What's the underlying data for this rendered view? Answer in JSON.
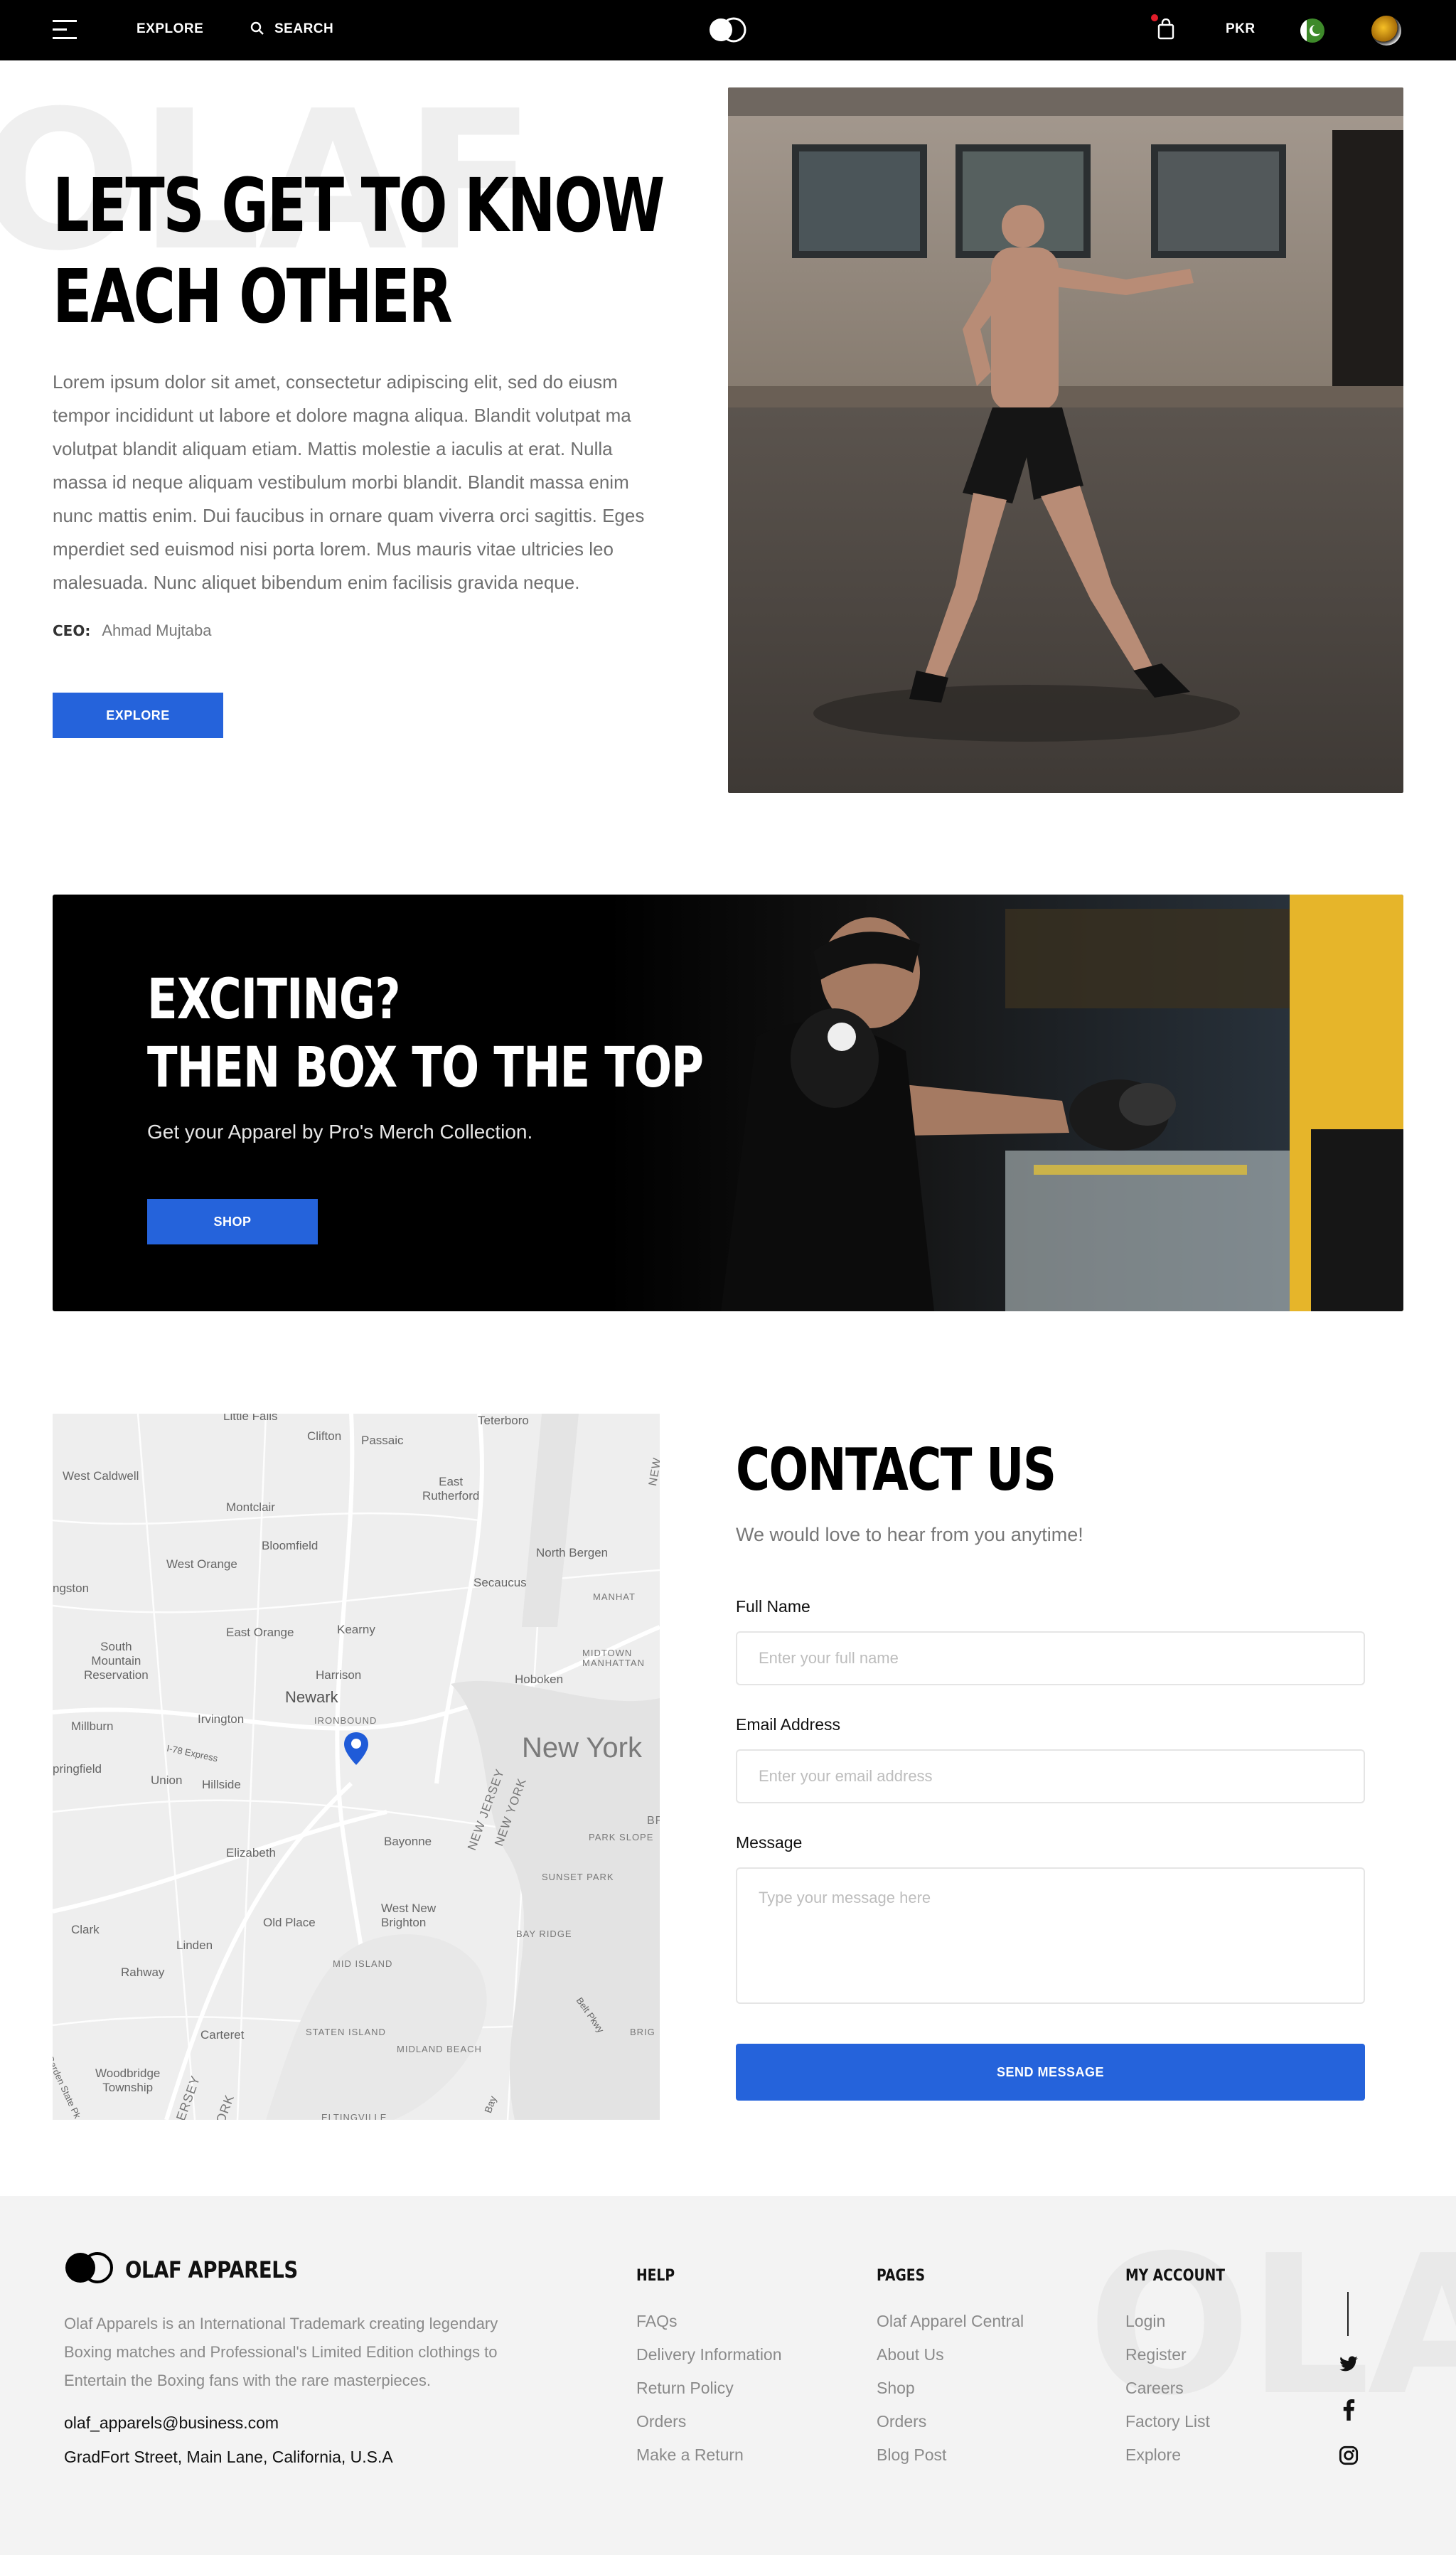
{
  "nav": {
    "explore": "EXPLORE",
    "search": "SEARCH",
    "currency": "PKR",
    "icons": [
      "menu-icon",
      "search-icon",
      "logo-icon",
      "shopping-bag-icon",
      "flag-icon",
      "avatar"
    ]
  },
  "hero": {
    "watermark": "OLAF",
    "title_line1": "LETS GET TO KNOW",
    "title_line2": "EACH OTHER",
    "body": "Lorem ipsum dolor sit amet, consectetur adipiscing elit, sed do eiusm tempor incididunt ut labore et dolore magna aliqua. Blandit volutpat ma volutpat blandit aliquam etiam. Mattis molestie a iaculis at erat. Nulla massa id neque aliquam vestibulum morbi blandit. Blandit massa enim nunc mattis enim. Dui faucibus in ornare quam viverra orci sagittis. Eges mperdiet sed euismod nisi porta lorem. Mus mauris vitae ultricies leo malesuada. Nunc aliquet bibendum enim facilisis gravida neque.",
    "ceo_label": "CEO:",
    "ceo_name": "Ahmad Mujtaba",
    "button": "EXPLORE"
  },
  "banner": {
    "title_line1": "EXCITING?",
    "title_line2": "THEN BOX TO THE TOP",
    "subtitle": "Get your Apparel by Pro's Merch Collection.",
    "button": "SHOP"
  },
  "map": {
    "labels": {
      "little_falls": "Little Falls",
      "clifton": "Clifton",
      "passaic": "Passaic",
      "teterboro": "Teterboro",
      "west_caldwell": "West Caldwell",
      "east_rutherford": "East\nRutherford",
      "montclair": "Montclair",
      "bloomfield": "Bloomfield",
      "north_bergen": "North Bergen",
      "west_orange": "West Orange",
      "secaucus": "Secaucus",
      "manhattan": "MANHAT",
      "livingston": "ngston",
      "east_orange": "East Orange",
      "kearny": "Kearny",
      "south_mountain": "South\nMountain\nReservation",
      "harrison": "Harrison",
      "midtown": "MIDTOWN\nMANHATTAN",
      "hoboken": "Hoboken",
      "newark": "Newark",
      "ironbound": "IRONBOUND",
      "millburn": "Millburn",
      "irvington": "Irvington",
      "new_york": "New York",
      "springfield": "pringfield",
      "union": "Union",
      "hillside": "Hillside",
      "i78": "I-78 Express",
      "new_jersey": "NEW JERSEY",
      "new_york_state": "NEW YORK",
      "park_slope": "PARK SLOPE",
      "bayonne": "Bayonne",
      "elizabeth": "Elizabeth",
      "sunset_park": "SUNSET PARK",
      "west_new_brighton": "West New\nBrighton",
      "clark": "Clark",
      "old_place": "Old Place",
      "bay_ridge": "BAY RIDGE",
      "linden": "Linden",
      "mid_island": "MID ISLAND",
      "rahway": "Rahway",
      "carteret": "Carteret",
      "staten_island": "STATEN ISLAND",
      "midland_beach": "MIDLAND BEACH",
      "woodbridge": "Woodbridge\nTownship",
      "garden_state": "Garden State Pk",
      "new_jersey_2": "ERSEY",
      "york_2": "ORK",
      "eltingville": "ELTINGVILLE",
      "bay": "Bay",
      "belt_pkwy": "Belt Pkwy",
      "brig": "BRIG",
      "new_north": "NEW",
      "br": "BR"
    },
    "pin": "location-pin-icon"
  },
  "contact": {
    "title": "CONTACT US",
    "subtitle": "We would love to hear from you anytime!",
    "full_name_label": "Full Name",
    "full_name_placeholder": "Enter your full name",
    "email_label": "Email Address",
    "email_placeholder": "Enter your email address",
    "message_label": "Message",
    "message_placeholder": "Type your message here",
    "button": "SEND MESSAGE"
  },
  "footer": {
    "brand": "OLAF APPARELS",
    "about": "Olaf Apparels is an International Trademark creating legendary Boxing matches and Professional's Limited Edition clothings to Entertain the Boxing fans with the rare masterpieces.",
    "email": "olaf_apparels@business.com",
    "address": "GradFort Street, Main Lane, California, U.S.A",
    "watermark": "OLAF",
    "help": {
      "title": "HELP",
      "items": [
        "FAQs",
        "Delivery Information",
        "Return Policy",
        "Orders",
        "Make a Return"
      ]
    },
    "pages": {
      "title": "PAGES",
      "items": [
        "Olaf Apparel Central",
        "About Us",
        "Shop",
        "Orders",
        "Blog Post"
      ]
    },
    "account": {
      "title": "MY ACCOUNT",
      "items": [
        "Login",
        "Register",
        "Careers",
        "Factory List",
        "Explore"
      ]
    },
    "social": [
      "twitter-icon",
      "facebook-icon",
      "instagram-icon"
    ]
  },
  "colors": {
    "accent": "#2563db",
    "nav_bg": "#000000",
    "footer_bg": "#f3f3f3",
    "notification": "#e11d2a"
  }
}
